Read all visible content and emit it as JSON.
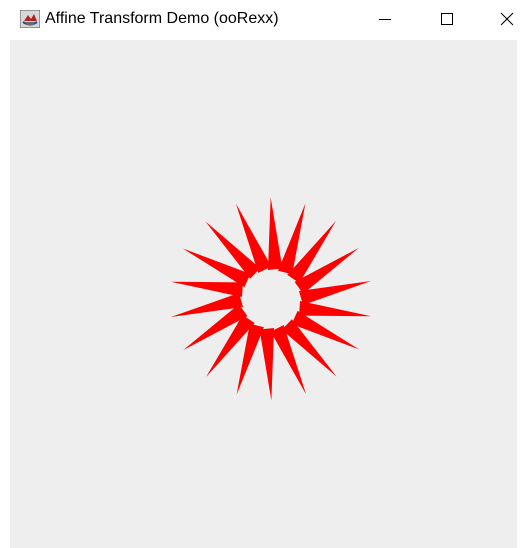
{
  "window": {
    "title": "Affine Transform Demo (ooRexx)",
    "app_icon": "java-coffee-cup-icon",
    "controls": {
      "minimize": "minimize-icon",
      "maximize": "maximize-icon",
      "close": "close-icon"
    }
  },
  "drawing": {
    "shape": "spike-wedge-ring",
    "fill_color": "#ff0000",
    "background_color": "#eeeeee",
    "copies": 18,
    "rotation_step_degrees": 20
  }
}
